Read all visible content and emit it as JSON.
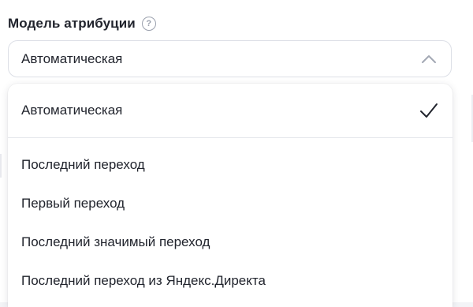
{
  "field": {
    "label": "Модель атрибуции",
    "help_icon": "question-circle-icon"
  },
  "select": {
    "value": "Автоматическая",
    "expanded": true,
    "chevron_icon": "chevron-up-icon"
  },
  "dropdown": {
    "selected_check_icon": "checkmark-icon",
    "options": [
      {
        "label": "Автоматическая",
        "selected": true
      },
      {
        "label": "Последний переход",
        "selected": false
      },
      {
        "label": "Первый переход",
        "selected": false
      },
      {
        "label": "Последний значимый переход",
        "selected": false
      },
      {
        "label": "Последний переход из Яндекс.Директа",
        "selected": false
      }
    ]
  },
  "colors": {
    "text": "#21242d",
    "muted_icon": "#9aa0ad",
    "border": "#dcdfe6",
    "divider": "#e4e6eb"
  }
}
